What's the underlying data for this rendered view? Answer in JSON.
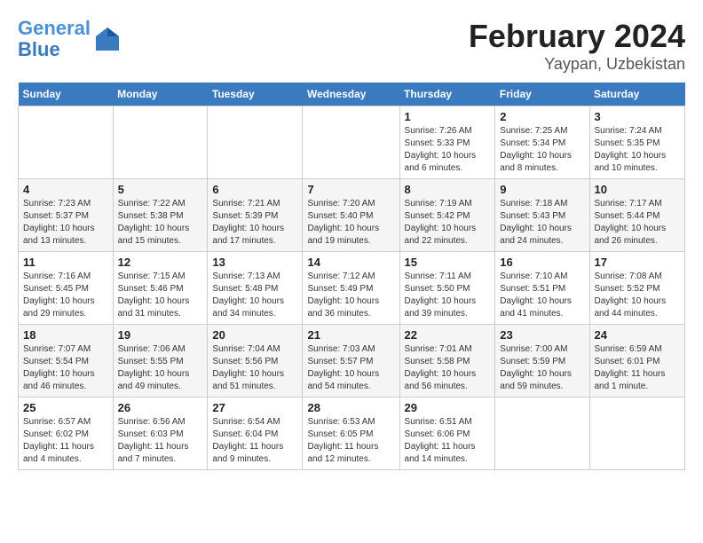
{
  "header": {
    "logo_line1": "General",
    "logo_line2": "Blue",
    "title": "February 2024",
    "subtitle": "Yaypan, Uzbekistan"
  },
  "days_of_week": [
    "Sunday",
    "Monday",
    "Tuesday",
    "Wednesday",
    "Thursday",
    "Friday",
    "Saturday"
  ],
  "weeks": [
    [
      {
        "day": "",
        "info": ""
      },
      {
        "day": "",
        "info": ""
      },
      {
        "day": "",
        "info": ""
      },
      {
        "day": "",
        "info": ""
      },
      {
        "day": "1",
        "info": "Sunrise: 7:26 AM\nSunset: 5:33 PM\nDaylight: 10 hours\nand 6 minutes."
      },
      {
        "day": "2",
        "info": "Sunrise: 7:25 AM\nSunset: 5:34 PM\nDaylight: 10 hours\nand 8 minutes."
      },
      {
        "day": "3",
        "info": "Sunrise: 7:24 AM\nSunset: 5:35 PM\nDaylight: 10 hours\nand 10 minutes."
      }
    ],
    [
      {
        "day": "4",
        "info": "Sunrise: 7:23 AM\nSunset: 5:37 PM\nDaylight: 10 hours\nand 13 minutes."
      },
      {
        "day": "5",
        "info": "Sunrise: 7:22 AM\nSunset: 5:38 PM\nDaylight: 10 hours\nand 15 minutes."
      },
      {
        "day": "6",
        "info": "Sunrise: 7:21 AM\nSunset: 5:39 PM\nDaylight: 10 hours\nand 17 minutes."
      },
      {
        "day": "7",
        "info": "Sunrise: 7:20 AM\nSunset: 5:40 PM\nDaylight: 10 hours\nand 19 minutes."
      },
      {
        "day": "8",
        "info": "Sunrise: 7:19 AM\nSunset: 5:42 PM\nDaylight: 10 hours\nand 22 minutes."
      },
      {
        "day": "9",
        "info": "Sunrise: 7:18 AM\nSunset: 5:43 PM\nDaylight: 10 hours\nand 24 minutes."
      },
      {
        "day": "10",
        "info": "Sunrise: 7:17 AM\nSunset: 5:44 PM\nDaylight: 10 hours\nand 26 minutes."
      }
    ],
    [
      {
        "day": "11",
        "info": "Sunrise: 7:16 AM\nSunset: 5:45 PM\nDaylight: 10 hours\nand 29 minutes."
      },
      {
        "day": "12",
        "info": "Sunrise: 7:15 AM\nSunset: 5:46 PM\nDaylight: 10 hours\nand 31 minutes."
      },
      {
        "day": "13",
        "info": "Sunrise: 7:13 AM\nSunset: 5:48 PM\nDaylight: 10 hours\nand 34 minutes."
      },
      {
        "day": "14",
        "info": "Sunrise: 7:12 AM\nSunset: 5:49 PM\nDaylight: 10 hours\nand 36 minutes."
      },
      {
        "day": "15",
        "info": "Sunrise: 7:11 AM\nSunset: 5:50 PM\nDaylight: 10 hours\nand 39 minutes."
      },
      {
        "day": "16",
        "info": "Sunrise: 7:10 AM\nSunset: 5:51 PM\nDaylight: 10 hours\nand 41 minutes."
      },
      {
        "day": "17",
        "info": "Sunrise: 7:08 AM\nSunset: 5:52 PM\nDaylight: 10 hours\nand 44 minutes."
      }
    ],
    [
      {
        "day": "18",
        "info": "Sunrise: 7:07 AM\nSunset: 5:54 PM\nDaylight: 10 hours\nand 46 minutes."
      },
      {
        "day": "19",
        "info": "Sunrise: 7:06 AM\nSunset: 5:55 PM\nDaylight: 10 hours\nand 49 minutes."
      },
      {
        "day": "20",
        "info": "Sunrise: 7:04 AM\nSunset: 5:56 PM\nDaylight: 10 hours\nand 51 minutes."
      },
      {
        "day": "21",
        "info": "Sunrise: 7:03 AM\nSunset: 5:57 PM\nDaylight: 10 hours\nand 54 minutes."
      },
      {
        "day": "22",
        "info": "Sunrise: 7:01 AM\nSunset: 5:58 PM\nDaylight: 10 hours\nand 56 minutes."
      },
      {
        "day": "23",
        "info": "Sunrise: 7:00 AM\nSunset: 5:59 PM\nDaylight: 10 hours\nand 59 minutes."
      },
      {
        "day": "24",
        "info": "Sunrise: 6:59 AM\nSunset: 6:01 PM\nDaylight: 11 hours\nand 1 minute."
      }
    ],
    [
      {
        "day": "25",
        "info": "Sunrise: 6:57 AM\nSunset: 6:02 PM\nDaylight: 11 hours\nand 4 minutes."
      },
      {
        "day": "26",
        "info": "Sunrise: 6:56 AM\nSunset: 6:03 PM\nDaylight: 11 hours\nand 7 minutes."
      },
      {
        "day": "27",
        "info": "Sunrise: 6:54 AM\nSunset: 6:04 PM\nDaylight: 11 hours\nand 9 minutes."
      },
      {
        "day": "28",
        "info": "Sunrise: 6:53 AM\nSunset: 6:05 PM\nDaylight: 11 hours\nand 12 minutes."
      },
      {
        "day": "29",
        "info": "Sunrise: 6:51 AM\nSunset: 6:06 PM\nDaylight: 11 hours\nand 14 minutes."
      },
      {
        "day": "",
        "info": ""
      },
      {
        "day": "",
        "info": ""
      }
    ]
  ]
}
